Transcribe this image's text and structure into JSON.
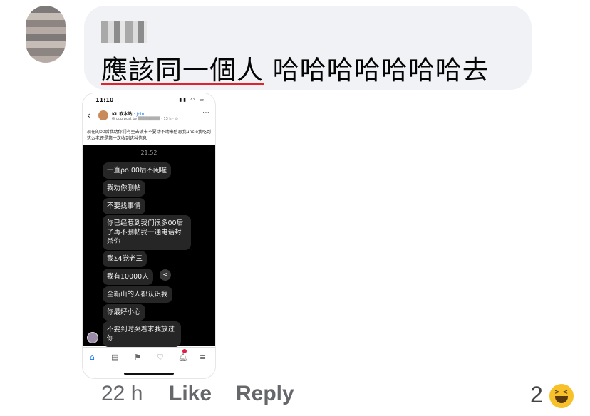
{
  "comment": {
    "text_tagged": "應該同一個人",
    "text_rest": " 哈哈哈哈哈哈哈去",
    "time": "22 h",
    "like_label": "Like",
    "reply_label": "Reply",
    "reaction_count": "2",
    "reaction_icon": "haha-emoji-icon"
  },
  "screenshot": {
    "status_time": "11:10",
    "group_name": "KL 吹水站",
    "join_label": "· Join",
    "group_sub": "Group post by",
    "post_age": "· 13 h · ◎",
    "post_text": "现在的00后我劝你们有空去读书不要动不动来信息我uncle我吃到这么老还是第一次收到这种信息",
    "chat_time": "21:52",
    "messages": [
      "一直ρo 00后不闲喔",
      "我劝你删帖",
      "不要找事情",
      "你已经惹到我们很多00后了再不删帖我一通电话封杀你",
      "我Σ4党老三",
      "我有10000人",
      "全新山的人都认识我",
      "你最好小心",
      "不要到时哭着求我放过你"
    ]
  }
}
